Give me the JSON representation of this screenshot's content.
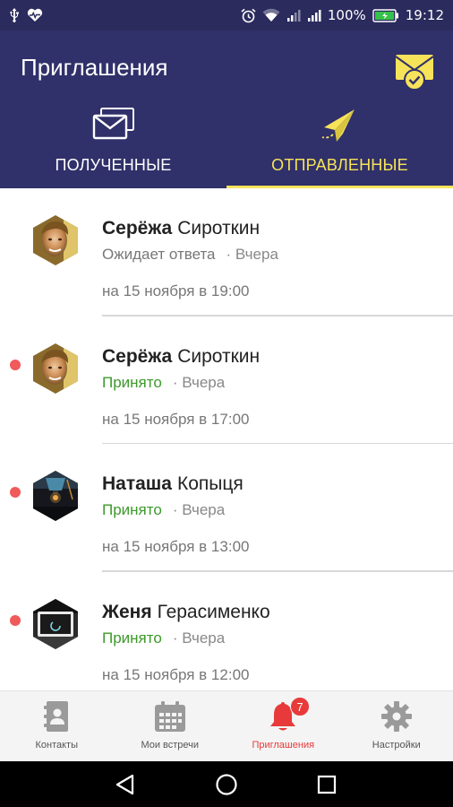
{
  "status_bar": {
    "battery": "100%",
    "time": "19:12"
  },
  "header": {
    "title": "Приглашения"
  },
  "tabs": [
    {
      "label": "ПОЛУЧЕННЫЕ",
      "active": false
    },
    {
      "label": "ОТПРАВЛЕННЫЕ",
      "active": true
    }
  ],
  "invitations": [
    {
      "first_name": "Серёжа",
      "last_name": "Сироткин",
      "status": "Ожидает ответа",
      "when": "· Вчера",
      "time": "на 15 ноября в 19:00",
      "unread": false
    },
    {
      "first_name": "Серёжа",
      "last_name": "Сироткин",
      "status": "Принято",
      "when": "· Вчера",
      "time": "на 15 ноября в 17:00",
      "unread": true
    },
    {
      "first_name": "Наташа",
      "last_name": "Копыця",
      "status": "Принято",
      "when": "· Вчера",
      "time": "на 15 ноября в 13:00",
      "unread": true
    },
    {
      "first_name": "Женя",
      "last_name": "Герасименко",
      "status": "Принято",
      "when": "· Вчера",
      "time": "на 15 ноября в 12:00",
      "unread": true
    }
  ],
  "bottom_nav": {
    "items": [
      {
        "label": "Контакты",
        "icon": "contacts-icon"
      },
      {
        "label": "Мои встречи",
        "icon": "calendar-icon"
      },
      {
        "label": "Приглашения",
        "icon": "bell-icon",
        "badge": "7",
        "active": true
      },
      {
        "label": "Настройки",
        "icon": "gear-icon"
      }
    ]
  },
  "colors": {
    "header_bg": "#30306a",
    "accent_yellow": "#f7e35a",
    "accepted_green": "#3c9a2a",
    "alert_red": "#e83a3a",
    "unread_dot": "#f05a5a"
  }
}
